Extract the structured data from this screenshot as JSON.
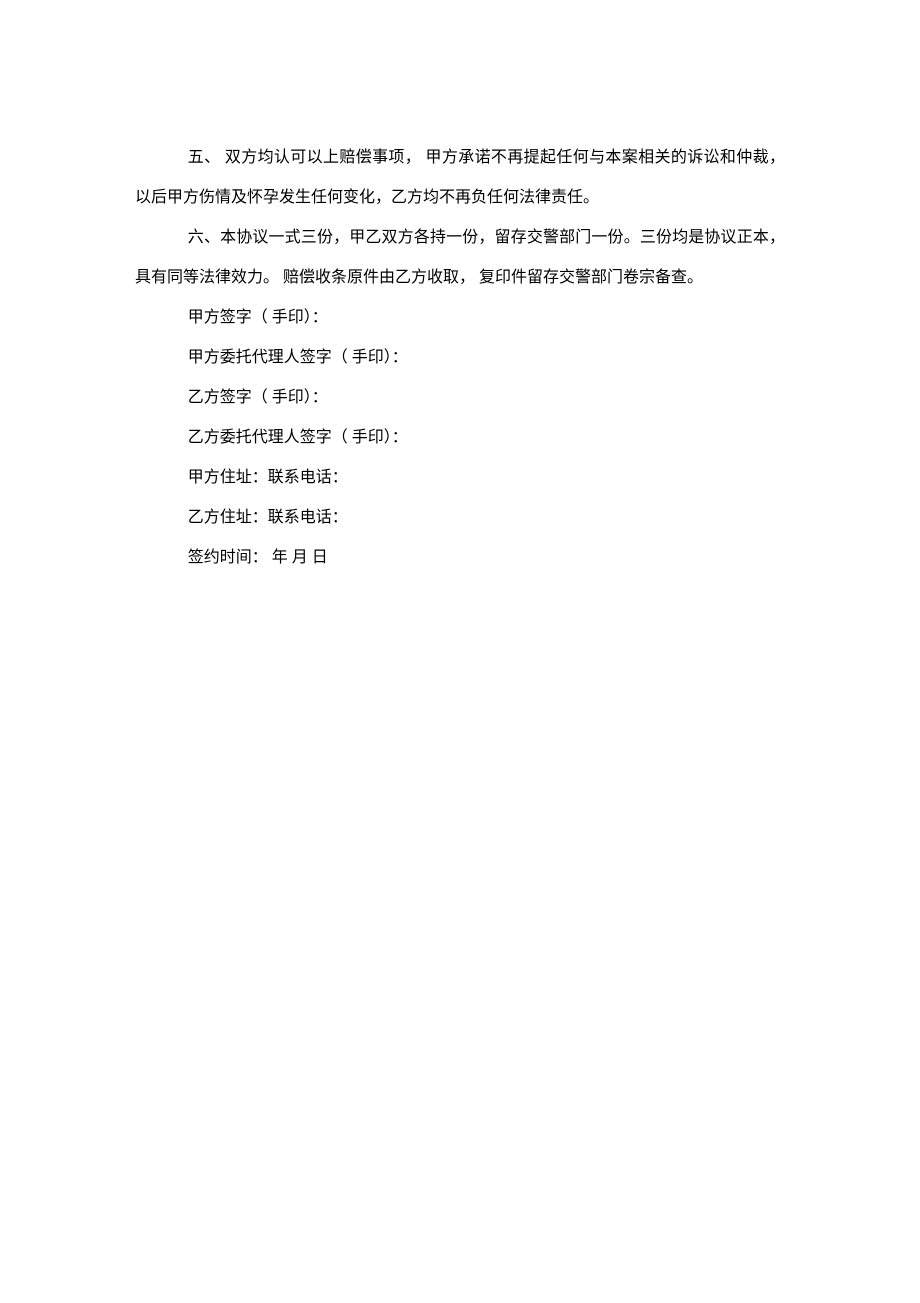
{
  "paragraphs": {
    "p1": "五、 双方均认可以上赔偿事项， 甲方承诺不再提起任何与本案相关的诉讼和仲裁，以后甲方伤情及怀孕发生任何变化，乙方均不再负任何法律责任。",
    "p2": "六、本协议一式三份，甲乙双方各持一份，留存交警部门一份。三份均是协议正本， 具有同等法律效力。 赔偿收条原件由乙方收取， 复印件留存交警部门卷宗备查。"
  },
  "signatures": {
    "s1": "甲方签字（ 手印）：",
    "s2": "甲方委托代理人签字（ 手印）：",
    "s3": "乙方签字（ 手印）：",
    "s4": "乙方委托代理人签字（ 手印）：",
    "s5": "甲方住址：联系电话：",
    "s6": "乙方住址：联系电话：",
    "s7": "签约时间： 年  月  日"
  }
}
